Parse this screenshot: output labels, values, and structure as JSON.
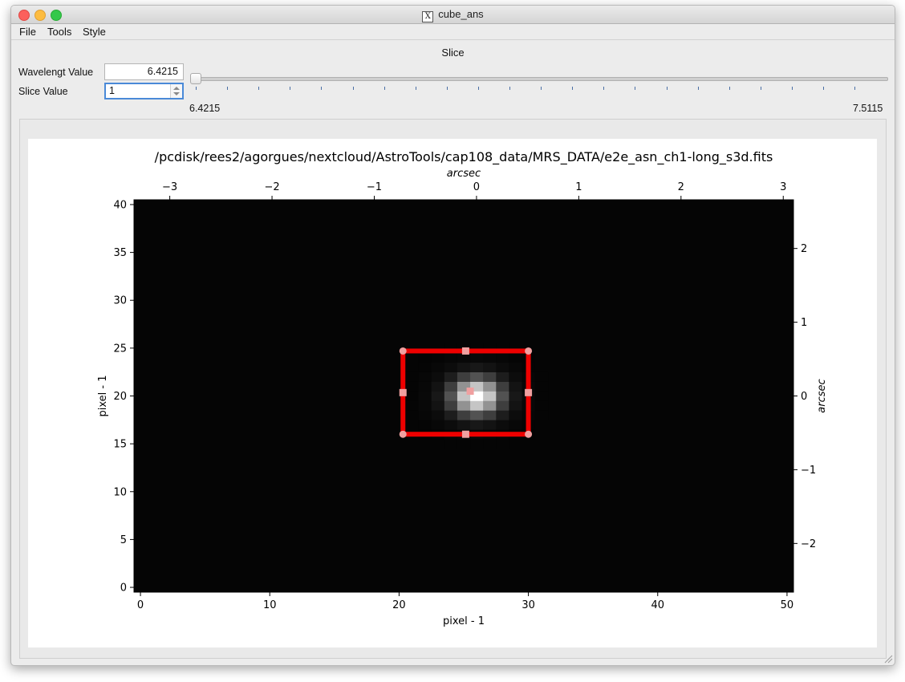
{
  "window": {
    "title": "cube_ans",
    "icon": "x11-icon"
  },
  "menu": {
    "items": [
      "File",
      "Tools",
      "Style"
    ]
  },
  "slice_panel": {
    "title": "Slice",
    "wavelength_label": "Wavelengt Value",
    "wavelength_value": "6.4215",
    "slice_label": "Slice Value",
    "slice_value": "1",
    "slider_min_label": "6.4215",
    "slider_max_label": "7.5115",
    "slider_fraction": 0.0
  },
  "colors": {
    "roi_box": "#ee0000",
    "roi_handle": "#f0a0a0",
    "image_bg": "#050505"
  },
  "chart_data": {
    "type": "heatmap",
    "title": "/pcdisk/rees2/agorgues/nextcloud/AstroTools/cap108_data/MRS_DATA/e2e_asn_ch1-long_s3d.fits",
    "xlabel": "pixel - 1",
    "ylabel": "pixel - 1",
    "top_xlabel": "arcsec",
    "right_ylabel": "arcsec",
    "xlim": [
      -0.5,
      50.5
    ],
    "ylim": [
      -0.5,
      40.5
    ],
    "xticks": [
      0,
      10,
      20,
      30,
      40,
      50
    ],
    "xtick_labels": [
      "0",
      "10",
      "20",
      "30",
      "40",
      "50"
    ],
    "yticks": [
      0,
      5,
      10,
      15,
      20,
      25,
      30,
      35,
      40
    ],
    "ytick_labels": [
      "0",
      "5",
      "10",
      "15",
      "20",
      "25",
      "30",
      "35",
      "40"
    ],
    "top_xlim": [
      -3.35,
      3.1
    ],
    "top_xticks": [
      -3,
      -2,
      -1,
      0,
      1,
      2,
      3
    ],
    "top_xtick_labels": [
      "−3",
      "−2",
      "−1",
      "0",
      "1",
      "2",
      "3"
    ],
    "right_ylim": [
      -2.66,
      2.66
    ],
    "right_yticks": [
      -2,
      -1,
      0,
      1,
      2
    ],
    "right_ytick_labels": [
      "−2",
      "−1",
      "0",
      "1",
      "2"
    ],
    "source": {
      "x": 26,
      "y": 20,
      "peak": 1.0
    },
    "roi": {
      "x0": 20.3,
      "x1": 30,
      "y0": 16,
      "y1": 24.7
    }
  }
}
